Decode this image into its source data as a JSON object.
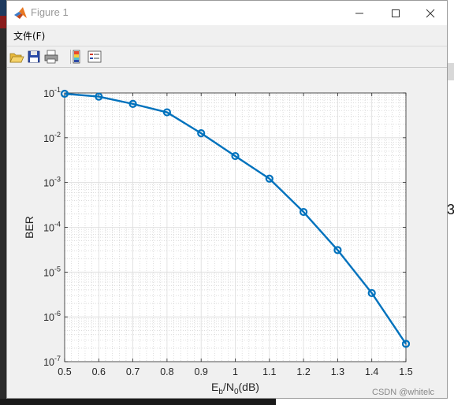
{
  "window": {
    "title": "Figure 1",
    "menu": {
      "file_label": "文件(F)"
    },
    "toolbar": [
      "open-icon",
      "save-icon",
      "print-icon",
      "colorbar-icon",
      "legend-icon"
    ]
  },
  "background": {
    "partial_text": "3"
  },
  "watermark": "CSDN @whitelc",
  "chart_data": {
    "type": "line",
    "xlabel": "Eb/N0(dB)",
    "ylabel": "BER",
    "xlim": [
      0.5,
      1.5
    ],
    "ylim": [
      1e-07,
      0.1
    ],
    "yscale": "log",
    "grid": true,
    "minor_grid": true,
    "x_ticks": [
      "0.5",
      "0.6",
      "0.7",
      "0.8",
      "0.9",
      "1",
      "1.1",
      "1.2",
      "1.3",
      "1.4",
      "1.5"
    ],
    "y_ticks": [
      {
        "base": "10",
        "exp": "-7"
      },
      {
        "base": "10",
        "exp": "-6"
      },
      {
        "base": "10",
        "exp": "-5"
      },
      {
        "base": "10",
        "exp": "-4"
      },
      {
        "base": "10",
        "exp": "-3"
      },
      {
        "base": "10",
        "exp": "-2"
      },
      {
        "base": "10",
        "exp": "-1"
      }
    ],
    "series": [
      {
        "marker": "o",
        "color": "#0072BD",
        "x": [
          0.5,
          0.6,
          0.7,
          0.8,
          0.9,
          1.0,
          1.1,
          1.2,
          1.3,
          1.4,
          1.5
        ],
        "y": [
          0.096,
          0.083,
          0.057,
          0.037,
          0.0126,
          0.0039,
          0.00122,
          0.00022,
          3.1e-05,
          3.4e-06,
          2.5e-07
        ]
      }
    ]
  }
}
